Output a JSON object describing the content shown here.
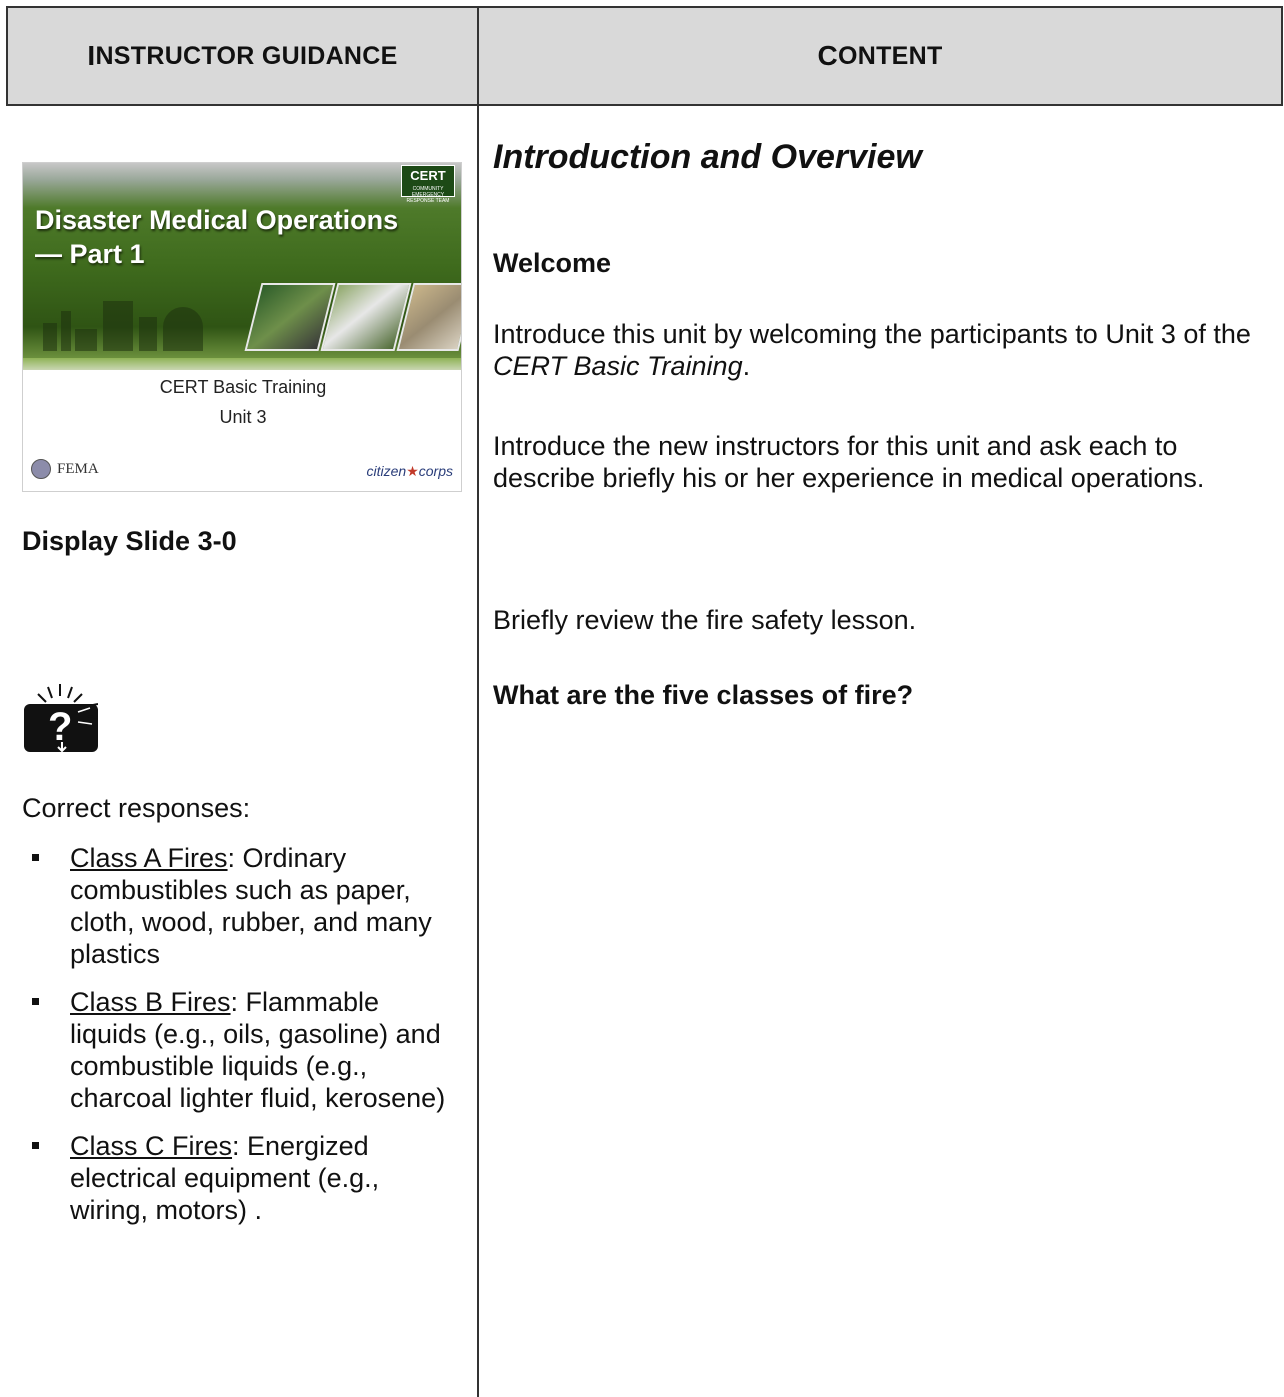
{
  "header": {
    "left_first": "I",
    "left_rest": "NSTRUCTOR GUIDANCE",
    "right_first": "C",
    "right_rest": "ONTENT"
  },
  "slide": {
    "title_line1": "Disaster Medical Operations",
    "title_line2": "— Part 1",
    "subtitle_line1": "CERT Basic Training",
    "subtitle_line2": "Unit 3",
    "logo_fema": "FEMA",
    "logo_citizen": "citizen",
    "logo_corps": "corps",
    "logo_cert": "CERT"
  },
  "guidance": {
    "display_slide": "Display Slide 3-0",
    "correct_responses": "Correct responses:",
    "fires": [
      {
        "name": "Class A Fires",
        "desc": ":  Ordinary combustibles such as paper, cloth, wood, rubber, and many plastics"
      },
      {
        "name": "Class B Fires",
        "desc": ":  Flammable liquids (e.g., oils, gasoline) and combustible liquids (e.g., charcoal lighter fluid, kerosene)"
      },
      {
        "name": "Class C Fires",
        "desc": ":  Energized electrical equipment (e.g., wiring, motors)  ."
      }
    ]
  },
  "content": {
    "heading": "Introduction and Overview",
    "welcome": "Welcome",
    "intro_part1": "Introduce this unit by welcoming the participants to Unit 3 of the ",
    "intro_italic": "CERT Basic Training",
    "intro_end": ".",
    "instructors": "Introduce the new instructors for this unit and ask each to describe briefly his or her experience in medical operations.",
    "review": "Briefly review the fire safety lesson.",
    "question": "What are the five classes of fire?"
  }
}
